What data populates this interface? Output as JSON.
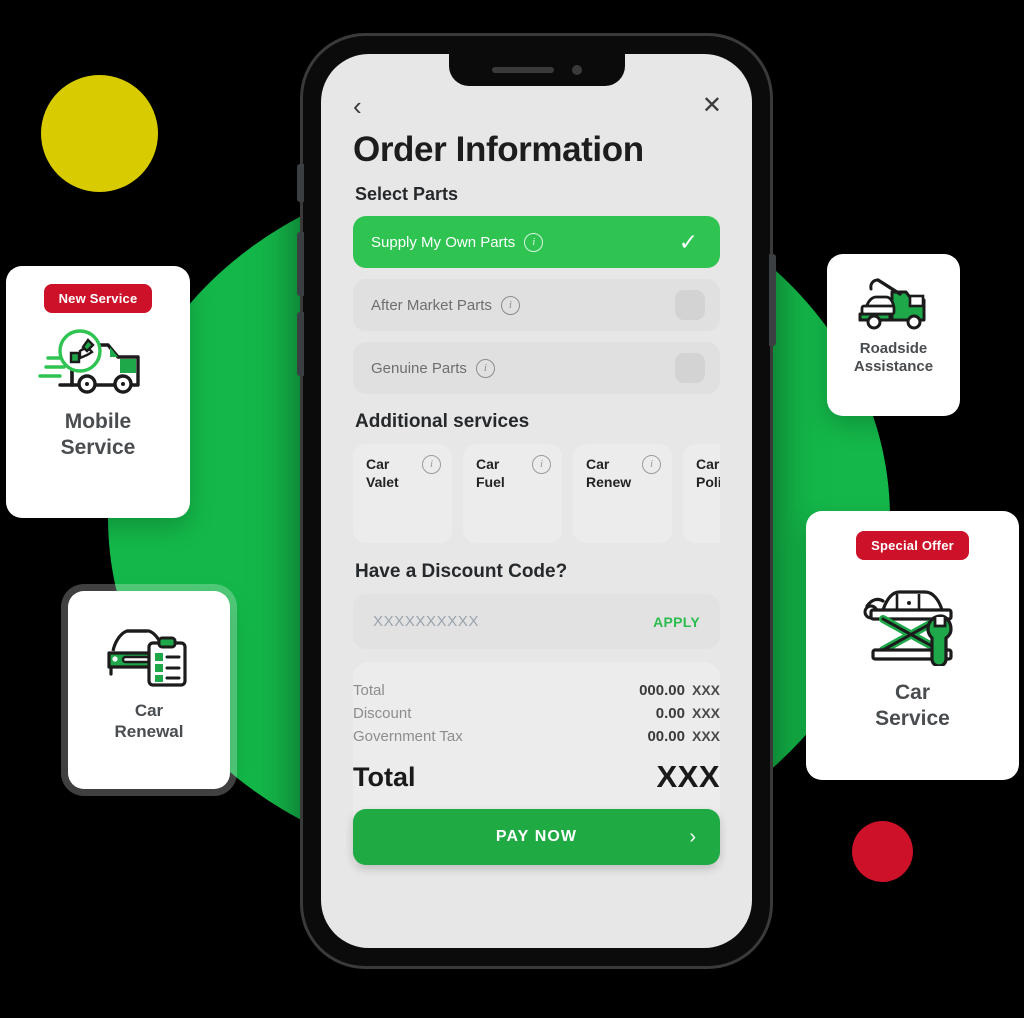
{
  "palette": {
    "brand_green": "#14b84a",
    "accent_green": "#2fc452",
    "pay_green": "#1faa43",
    "badge_red": "#cc1129",
    "yellow": "#d8cc00",
    "screen_bg": "#e7e7e7"
  },
  "phone": {
    "nav": {
      "back_icon": "chevron-left-icon",
      "close_icon": "close-icon"
    },
    "title": "Order Information",
    "select_parts": {
      "label": "Select Parts",
      "options": [
        {
          "label": "Supply My Own Parts",
          "selected": true,
          "check": "✓"
        },
        {
          "label": "After Market Parts",
          "selected": false,
          "check": ""
        },
        {
          "label": "Genuine Parts",
          "selected": false,
          "check": ""
        }
      ],
      "info_icon": "info-icon"
    },
    "additional_services": {
      "label": "Additional services",
      "items": [
        {
          "line1": "Car",
          "line2": "Valet"
        },
        {
          "line1": "Car",
          "line2": "Fuel"
        },
        {
          "line1": "Car",
          "line2": "Renew"
        },
        {
          "line1": "Car",
          "line2": "Polish"
        }
      ]
    },
    "discount": {
      "label": "Have a Discount Code?",
      "placeholder": "XXXXXXXXXX",
      "apply_label": "APPLY"
    },
    "totals": {
      "rows": [
        {
          "label": "Total",
          "value": "000.00",
          "currency": "XXX"
        },
        {
          "label": "Discount",
          "value": "0.00",
          "currency": "XXX"
        },
        {
          "label": "Government Tax",
          "value": "00.00",
          "currency": "XXX"
        }
      ],
      "grand_label": "Total",
      "grand_value": "XXX"
    },
    "pay_button": {
      "label": "PAY NOW",
      "chevron": "›"
    }
  },
  "cards": {
    "mobile": {
      "badge": "New Service",
      "line1": "Mobile",
      "line2": "Service",
      "icon": "mobile-service-truck-icon"
    },
    "renewal": {
      "badge": "",
      "line1": "Car",
      "line2": "Renewal",
      "icon": "car-checklist-icon"
    },
    "roadside": {
      "badge": "",
      "line1": "Roadside",
      "line2": "Assistance",
      "icon": "tow-truck-icon"
    },
    "service": {
      "badge": "Special Offer",
      "line1": "Car",
      "line2": "Service",
      "icon": "car-lift-wrench-icon"
    }
  }
}
